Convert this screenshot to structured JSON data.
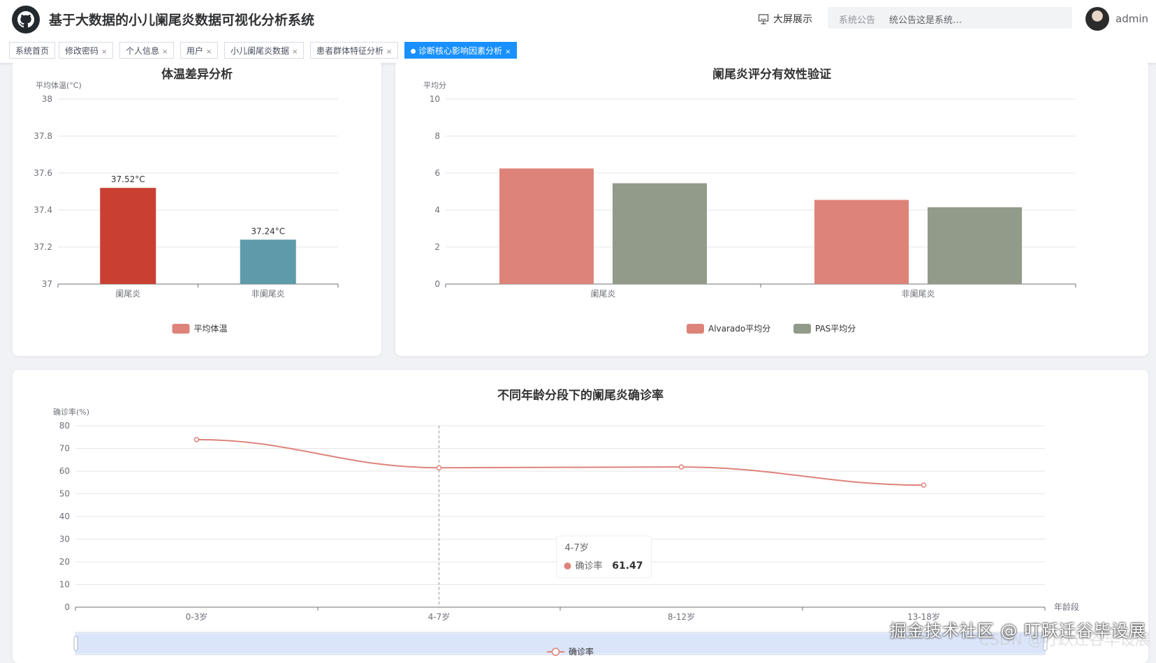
{
  "header": {
    "title": "基于大数据的小儿阑尾炎数据可视化分析系统",
    "bigscreen_label": "大屏展示",
    "notice_label": "系统公告",
    "notice_text": "统公告这是系统…",
    "username": "admin",
    "icons": {
      "logo": "github-icon",
      "bigscreen": "presentation-icon",
      "avatar": "user-avatar"
    }
  },
  "tags": [
    {
      "label": "系统首页",
      "closable": false,
      "active": false
    },
    {
      "label": "修改密码",
      "closable": true,
      "active": false
    },
    {
      "label": "个人信息",
      "closable": true,
      "active": false
    },
    {
      "label": "用户",
      "closable": true,
      "active": false
    },
    {
      "label": "小儿阑尾炎数据",
      "closable": true,
      "active": false
    },
    {
      "label": "患者群体特征分析",
      "closable": true,
      "active": false
    },
    {
      "label": "诊断核心影响因素分析",
      "closable": true,
      "active": true
    }
  ],
  "tag_close_symbol": "×",
  "chart_data": [
    {
      "type": "bar",
      "title": "体温差异分析",
      "ylabel": "平均体温(°C)",
      "ylim": [
        37,
        38
      ],
      "yticks": [
        "38",
        "37.8",
        "37.6",
        "37.4",
        "37.2",
        "37"
      ],
      "categories": [
        "阑尾炎",
        "非阑尾炎"
      ],
      "values": [
        37.52,
        37.24
      ],
      "data_labels": [
        "37.52°C",
        "37.24°C"
      ],
      "colors": [
        "#c94032",
        "#5e9baa"
      ],
      "series": [
        {
          "name": "平均体温",
          "color": "#de837a"
        }
      ],
      "legend": "bottom-center",
      "grid": true
    },
    {
      "type": "bar",
      "title": "阑尾炎评分有效性验证",
      "ylabel": "平均分",
      "ylim": [
        0,
        10
      ],
      "yticks": [
        "10",
        "8",
        "6",
        "4",
        "2",
        "0"
      ],
      "categories": [
        "阑尾炎",
        "非阑尾炎"
      ],
      "series": [
        {
          "name": "Alvarado平均分",
          "values": [
            6.25,
            4.55
          ],
          "color": "#de837a"
        },
        {
          "name": "PAS平均分",
          "values": [
            5.45,
            4.15
          ],
          "color": "#929b8a"
        }
      ],
      "legend": "bottom-center",
      "grid": true
    },
    {
      "type": "line",
      "title": "不同年龄分段下的阑尾炎确诊率",
      "ylabel": "确诊率(%)",
      "xlabel": "年龄段",
      "ylim": [
        0,
        80
      ],
      "yticks": [
        "80",
        "70",
        "60",
        "50",
        "40",
        "30",
        "20",
        "10",
        "0"
      ],
      "categories": [
        "0-3岁",
        "4-7岁",
        "8-12岁",
        "13-18岁"
      ],
      "series": [
        {
          "name": "确诊率",
          "values": [
            73.9,
            61.47,
            61.8,
            53.8
          ],
          "color": "#de837a"
        }
      ],
      "tooltip": {
        "category": "4-7岁",
        "series": "确诊率",
        "value": "61.47"
      },
      "legend": "bottom-center",
      "grid": true,
      "datazoom": true
    }
  ],
  "watermark": {
    "main": "掘金技术社区 @ 叮跃迁谷毕设展",
    "sub": "CSDN @叮跃迁谷毕设展"
  }
}
